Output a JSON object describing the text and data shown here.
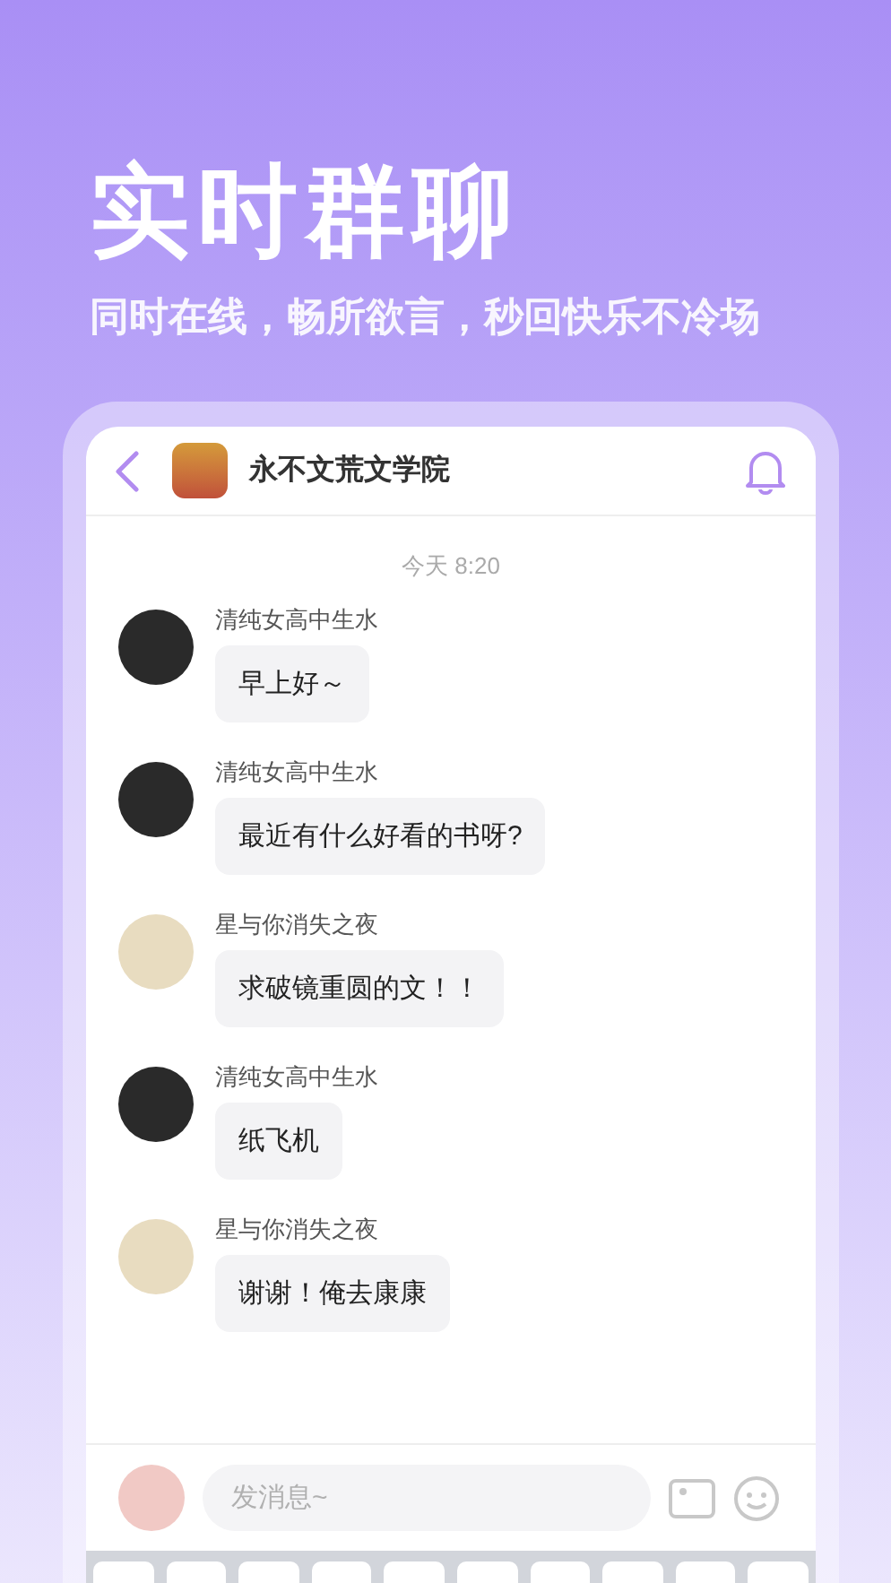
{
  "headline": "实时群聊",
  "subtitle": "同时在线，畅所欲言，秒回快乐不冷场",
  "chat": {
    "title": "永不文荒文学院",
    "timestamp": "今天 8:20",
    "messages": [
      {
        "sender": "清纯女高中生水",
        "text": "早上好～",
        "kind": "dark"
      },
      {
        "sender": "清纯女高中生水",
        "text": "最近有什么好看的书呀?",
        "kind": "dark"
      },
      {
        "sender": "星与你消失之夜",
        "text": "求破镜重圆的文！！",
        "kind": "light"
      },
      {
        "sender": "清纯女高中生水",
        "text": "纸飞机",
        "kind": "dark"
      },
      {
        "sender": "星与你消失之夜",
        "text": "谢谢！俺去康康",
        "kind": "light"
      }
    ],
    "input": {
      "placeholder": "发消息~"
    }
  }
}
